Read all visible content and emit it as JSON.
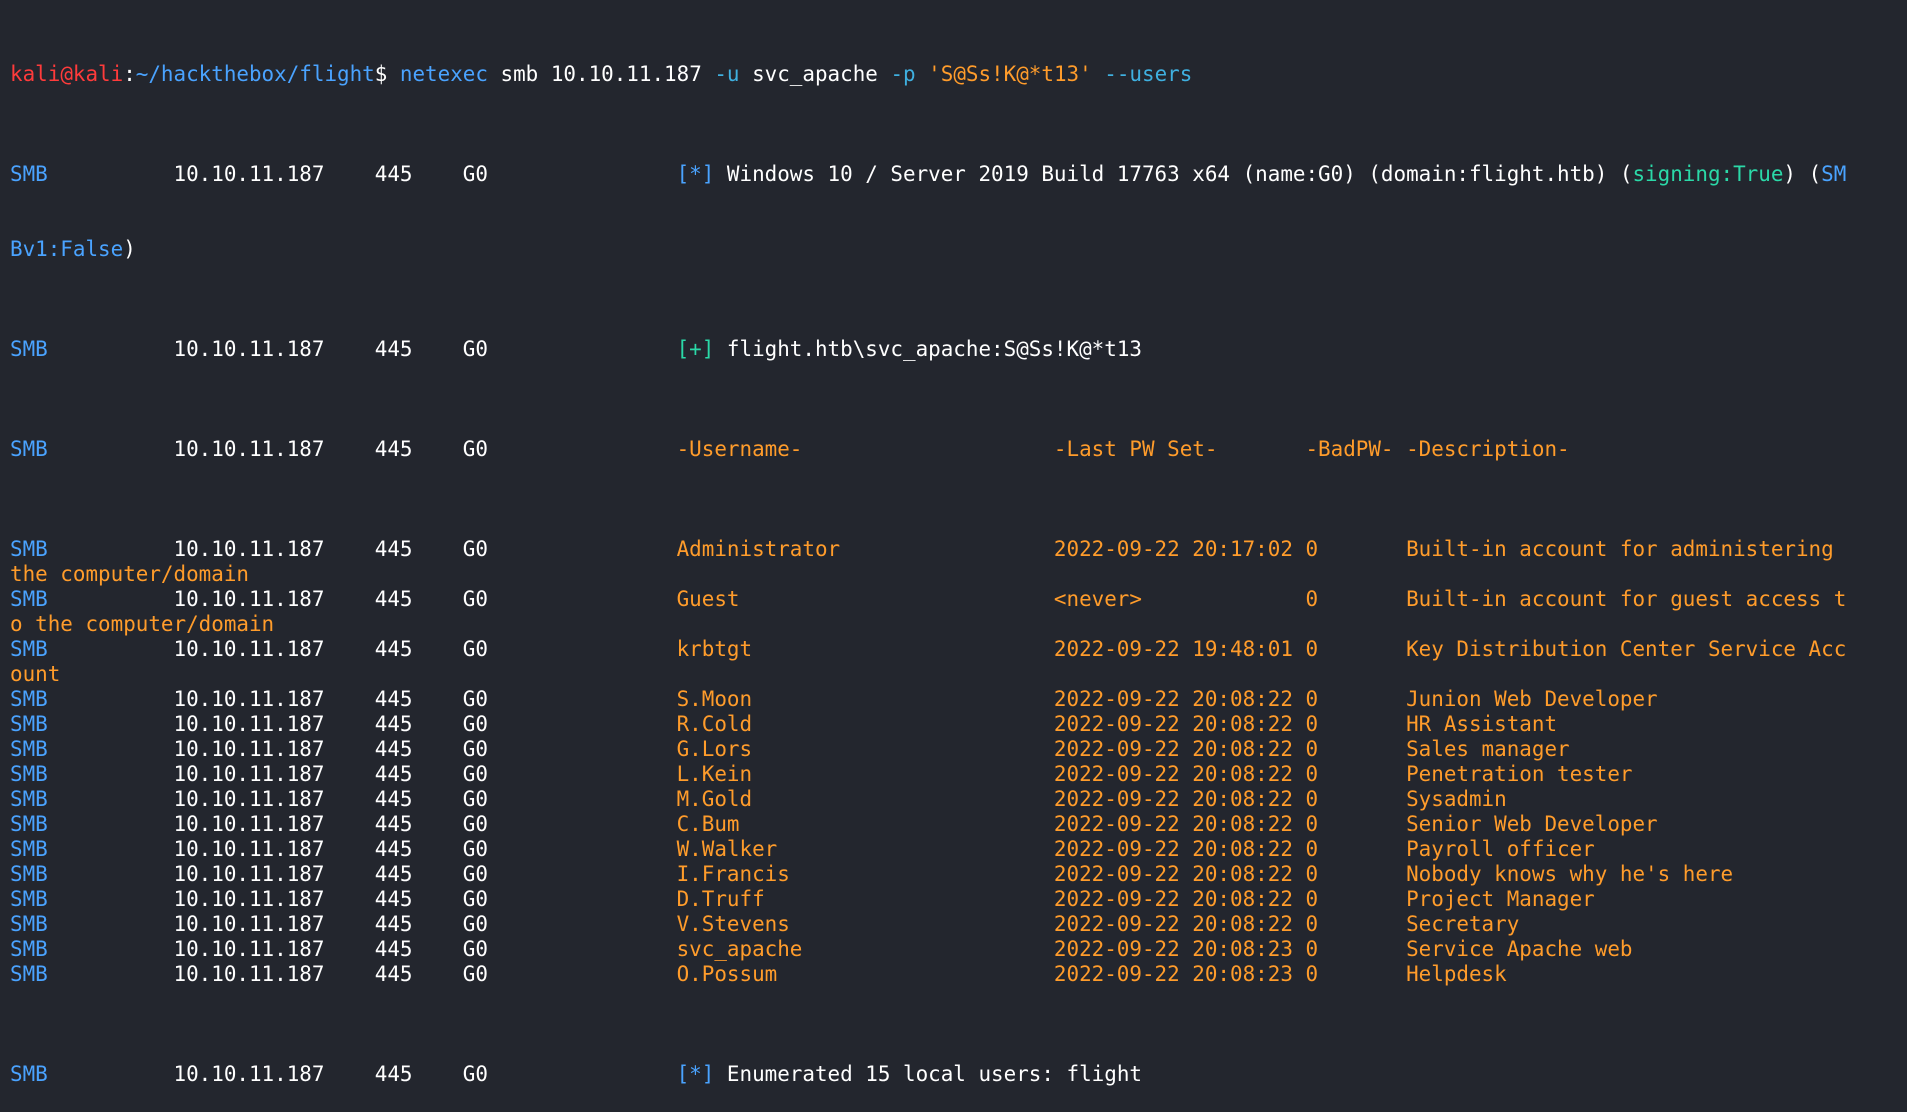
{
  "prompt": {
    "user": "kali",
    "at": "@",
    "host": "kali",
    "colon": ":",
    "path": "~/hackthebox/flight",
    "symbol": "$",
    "command": "netexec",
    "args": " smb 10.10.11.187 ",
    "u_flag": "-u",
    "u_val": " svc_apache ",
    "p_flag": "-p",
    "p_val": " 'S@Ss!K@*t13'",
    "users_flag": " --users"
  },
  "info_line": {
    "proto": "SMB",
    "prefix": "          10.10.11.187    445    G0               ",
    "marker": "[*]",
    "text": " Windows 10 / Server 2019 Build 17763 x64 (name:G0) (domain:flight.htb) (",
    "signing": "signing:True",
    "mid": ") (",
    "smb1a": "SM",
    "smb1b": "Bv1:False",
    "close": ")"
  },
  "auth_line": {
    "proto": "SMB",
    "prefix": "          10.10.11.187    445    G0               ",
    "marker": "[+]",
    "text": " flight.htb\\svc_apache:S@Ss!K@*t13"
  },
  "header_line": {
    "proto": "SMB",
    "prefix": "          10.10.11.187    445    G0               ",
    "text": "-Username-                    -Last PW Set-       -BadPW- -Description-"
  },
  "users": [
    {
      "proto": "SMB",
      "prefix": "          10.10.11.187    445    G0               ",
      "row": "Administrator                 2022-09-22 20:17:02 0       Built-in account for administering",
      "wrap": "the computer/domain"
    },
    {
      "proto": "SMB",
      "prefix": "          10.10.11.187    445    G0               ",
      "row": "Guest                         <never>             0       Built-in account for guest access t",
      "wrap": "o the computer/domain"
    },
    {
      "proto": "SMB",
      "prefix": "          10.10.11.187    445    G0               ",
      "row": "krbtgt                        2022-09-22 19:48:01 0       Key Distribution Center Service Acc",
      "wrap": "ount"
    },
    {
      "proto": "SMB",
      "prefix": "          10.10.11.187    445    G0               ",
      "row": "S.Moon                        2022-09-22 20:08:22 0       Junion Web Developer",
      "wrap": ""
    },
    {
      "proto": "SMB",
      "prefix": "          10.10.11.187    445    G0               ",
      "row": "R.Cold                        2022-09-22 20:08:22 0       HR Assistant",
      "wrap": ""
    },
    {
      "proto": "SMB",
      "prefix": "          10.10.11.187    445    G0               ",
      "row": "G.Lors                        2022-09-22 20:08:22 0       Sales manager",
      "wrap": ""
    },
    {
      "proto": "SMB",
      "prefix": "          10.10.11.187    445    G0               ",
      "row": "L.Kein                        2022-09-22 20:08:22 0       Penetration tester",
      "wrap": ""
    },
    {
      "proto": "SMB",
      "prefix": "          10.10.11.187    445    G0               ",
      "row": "M.Gold                        2022-09-22 20:08:22 0       Sysadmin",
      "wrap": ""
    },
    {
      "proto": "SMB",
      "prefix": "          10.10.11.187    445    G0               ",
      "row": "C.Bum                         2022-09-22 20:08:22 0       Senior Web Developer",
      "wrap": ""
    },
    {
      "proto": "SMB",
      "prefix": "          10.10.11.187    445    G0               ",
      "row": "W.Walker                      2022-09-22 20:08:22 0       Payroll officer",
      "wrap": ""
    },
    {
      "proto": "SMB",
      "prefix": "          10.10.11.187    445    G0               ",
      "row": "I.Francis                     2022-09-22 20:08:22 0       Nobody knows why he's here",
      "wrap": ""
    },
    {
      "proto": "SMB",
      "prefix": "          10.10.11.187    445    G0               ",
      "row": "D.Truff                       2022-09-22 20:08:22 0       Project Manager",
      "wrap": ""
    },
    {
      "proto": "SMB",
      "prefix": "          10.10.11.187    445    G0               ",
      "row": "V.Stevens                     2022-09-22 20:08:22 0       Secretary",
      "wrap": ""
    },
    {
      "proto": "SMB",
      "prefix": "          10.10.11.187    445    G0               ",
      "row": "svc_apache                    2022-09-22 20:08:23 0       Service Apache web",
      "wrap": ""
    },
    {
      "proto": "SMB",
      "prefix": "          10.10.11.187    445    G0               ",
      "row": "O.Possum                      2022-09-22 20:08:23 0       Helpdesk",
      "wrap": ""
    }
  ],
  "footer_line": {
    "proto": "SMB",
    "prefix": "          10.10.11.187    445    G0               ",
    "marker": "[*]",
    "text": " Enumerated 15 local users: flight"
  },
  "colors": {
    "background": "#23262e",
    "prompt_user": "#ff3b3b",
    "path": "#4aa3ff",
    "protocol": "#4aa3ff",
    "data": "#ff9c2b",
    "flag": "#3fb0e0",
    "signing": "#2bd9a8"
  }
}
